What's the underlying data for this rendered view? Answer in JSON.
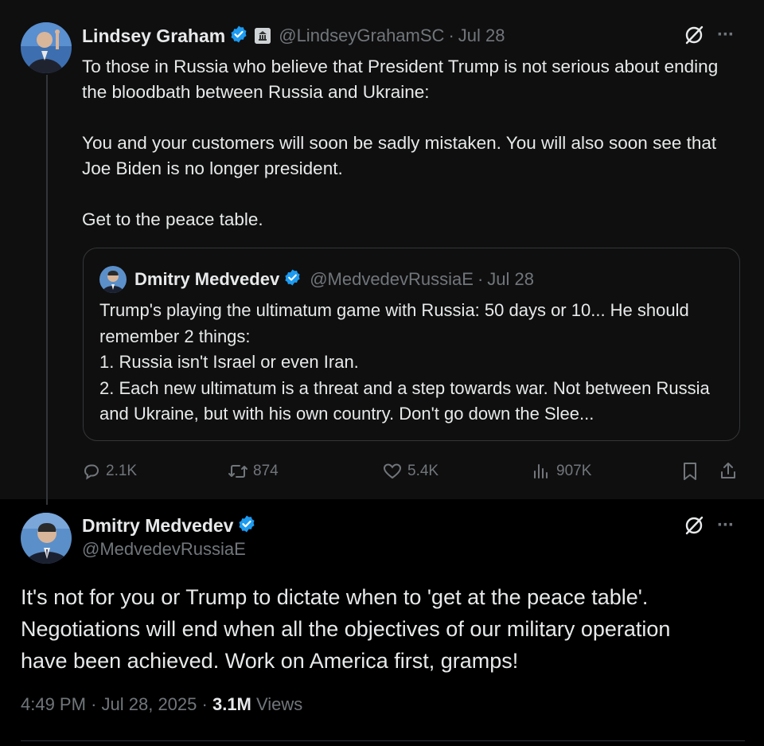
{
  "colors": {
    "verified_blue": "#1d9bf0",
    "text_primary": "#e7e9ea",
    "text_secondary": "#71767b",
    "border": "#333639"
  },
  "tweet1": {
    "author_name": "Lindsey Graham",
    "handle": "@LindseyGrahamSC",
    "separator": "·",
    "date": "Jul 28",
    "more_label": "···",
    "body_lines": [
      "To those in Russia who believe that President Trump is not serious about ending the bloodbath between Russia and Ukraine:",
      "You and your customers will soon be sadly mistaken. You will also soon see that Joe Biden is no longer president.",
      "Get to the peace table."
    ],
    "quote": {
      "author_name": "Dmitry Medvedev",
      "handle": "@MedvedevRussiaE",
      "separator": "·",
      "date": "Jul 28",
      "body_lines": [
        "Trump's playing the ultimatum game with Russia: 50 days or 10... He should remember 2 things:",
        "1. Russia isn't Israel or even Iran.",
        "2. Each new ultimatum is a threat and a step towards war. Not between Russia and Ukraine, but with his own country. Don't go down the Slee..."
      ]
    },
    "actions": {
      "replies": "2.1K",
      "reposts": "874",
      "likes": "5.4K",
      "views": "907K"
    }
  },
  "tweet2": {
    "author_name": "Dmitry Medvedev",
    "handle": "@MedvedevRussiaE",
    "more_label": "···",
    "body_lines": [
      "It's not for you or Trump to dictate when to 'get at the peace table'.",
      "Negotiations will end when all the objectives of our military operation",
      "have been achieved. Work on America first, gramps!"
    ],
    "time": "4:49 PM",
    "separator": "·",
    "date": "Jul 28, 2025",
    "views_count": "3.1M",
    "views_label": "Views"
  }
}
